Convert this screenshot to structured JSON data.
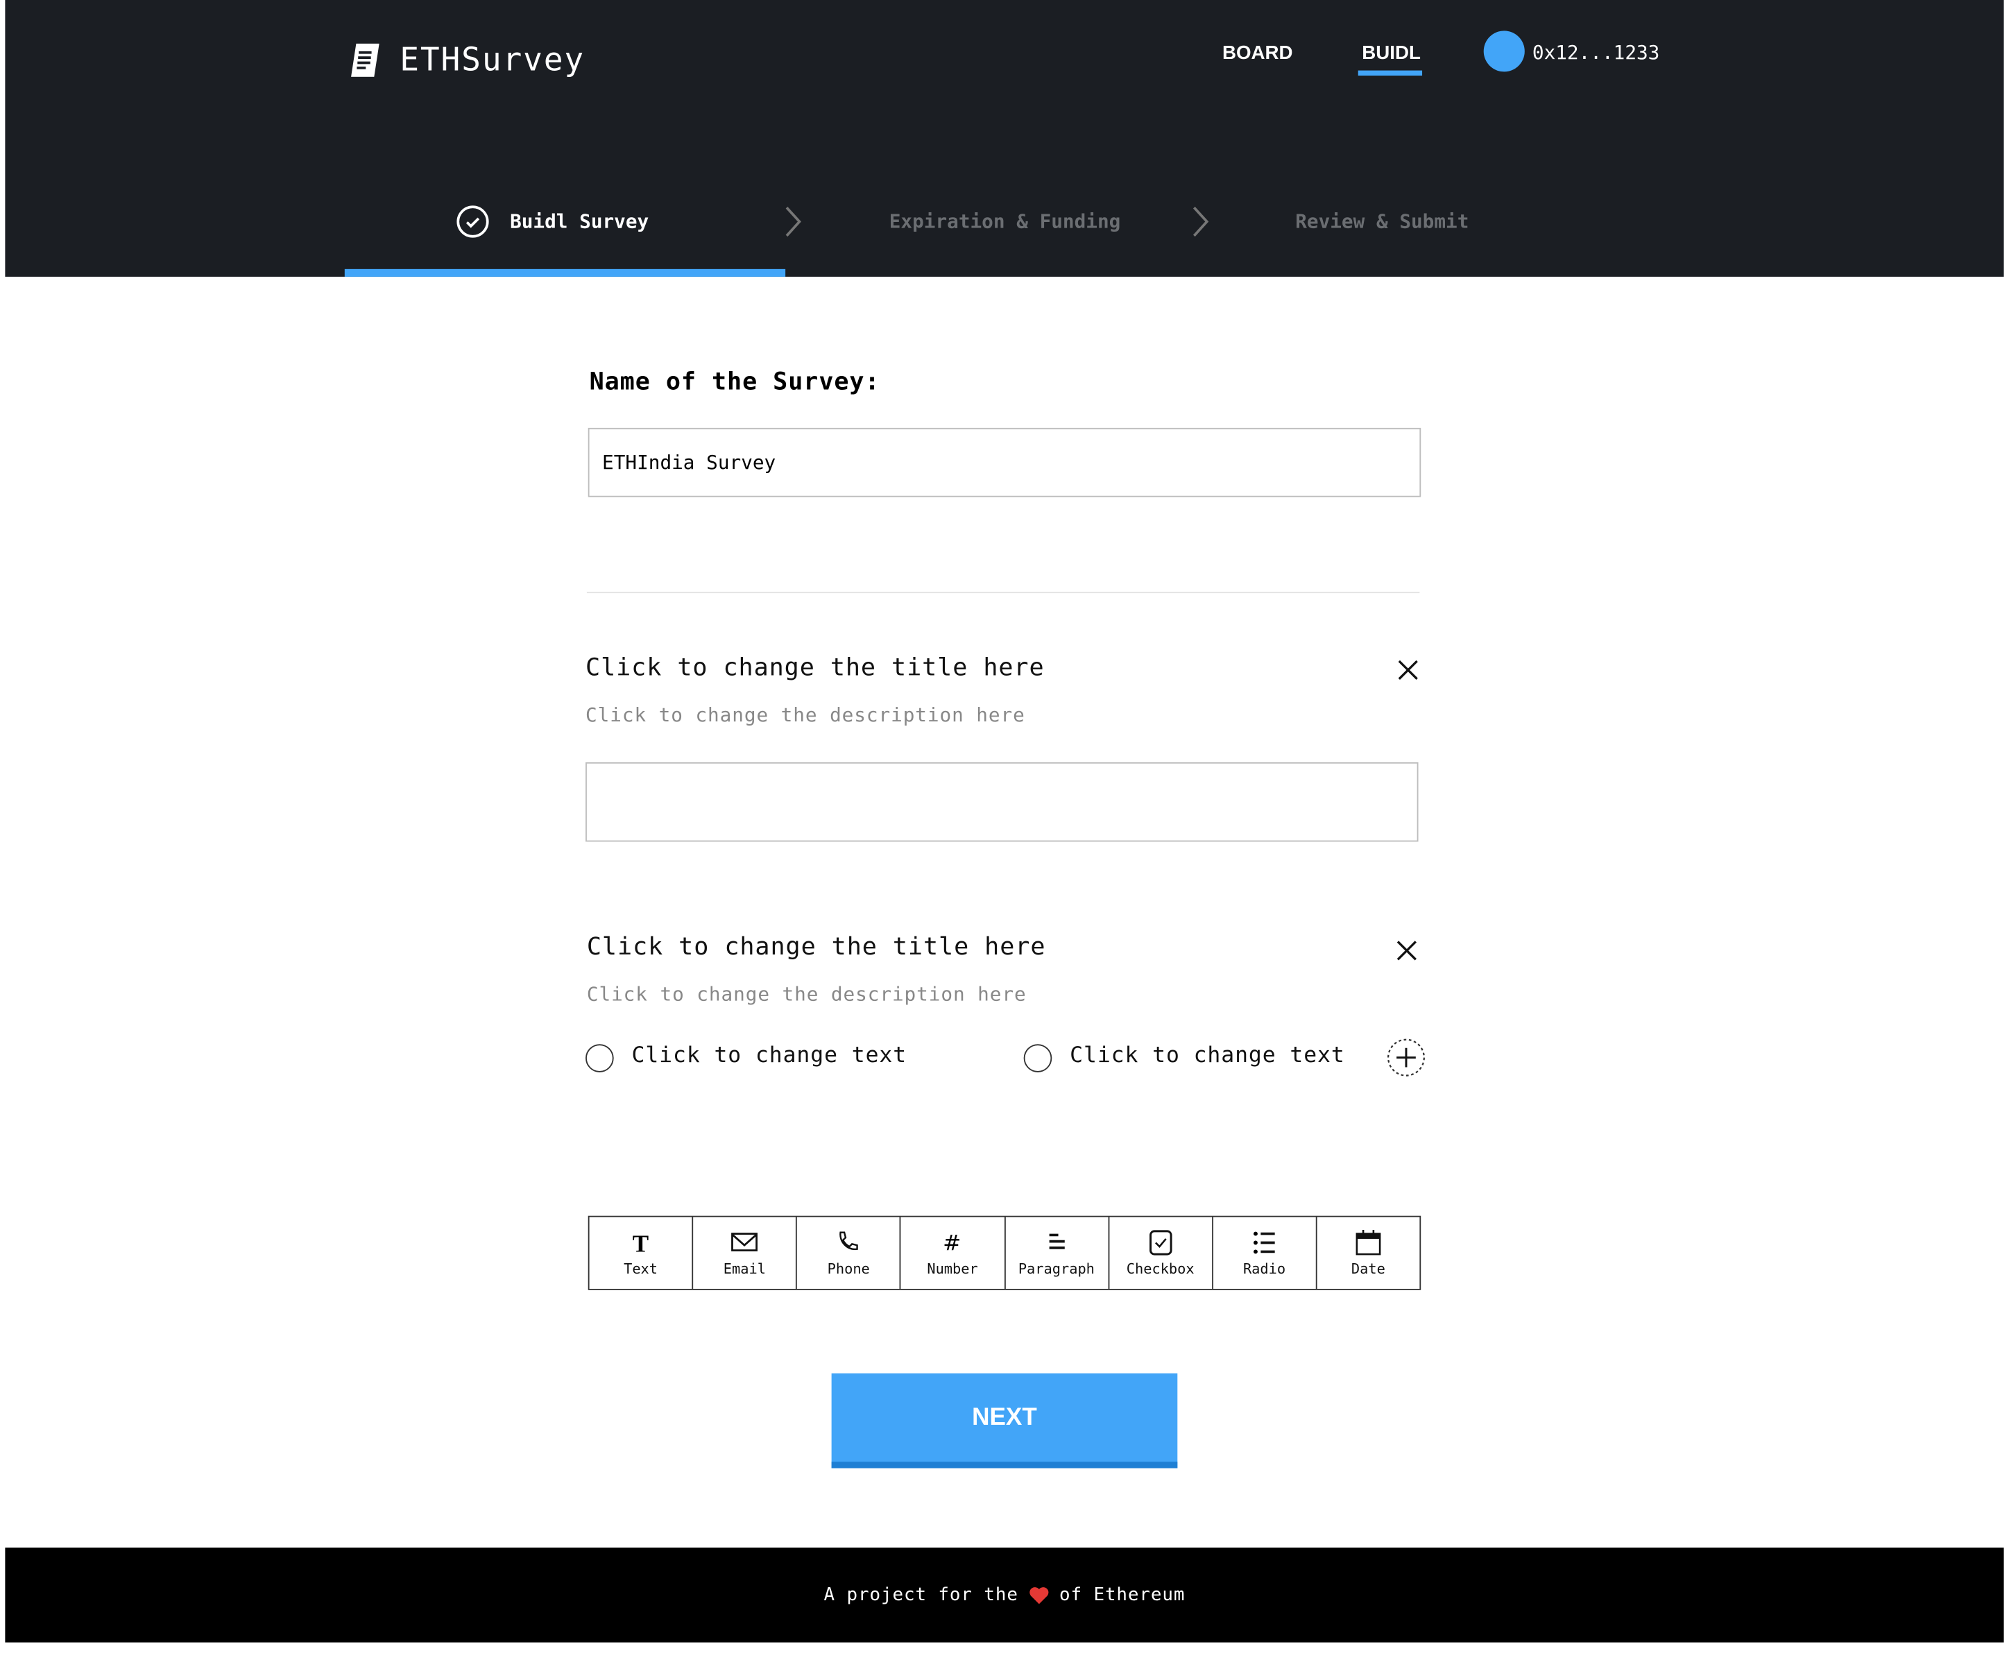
{
  "app": {
    "name": "ETHSurvey",
    "logo_icon": "document-icon"
  },
  "nav": {
    "items": [
      {
        "label": "BOARD",
        "active": false
      },
      {
        "label": "BUIDL",
        "active": true
      }
    ],
    "address": "0x12...1233"
  },
  "steps": [
    {
      "label": "Buidl Survey",
      "active": true,
      "icon": "check-circle-icon"
    },
    {
      "label": "Expiration & Funding",
      "active": false
    },
    {
      "label": "Review & Submit",
      "active": false
    }
  ],
  "survey": {
    "name_label": "Name of the Survey:",
    "name_value": "ETHIndia Survey"
  },
  "questions": [
    {
      "title": "Click to change the title here",
      "description": "Click to change the description here",
      "type": "text",
      "value": ""
    },
    {
      "title": "Click to change the title here",
      "description": "Click to change the description here",
      "type": "radio",
      "options": [
        "Click to change text",
        "Click to change text"
      ]
    }
  ],
  "toolbar": [
    {
      "label": "Text",
      "icon": "text-icon"
    },
    {
      "label": "Email",
      "icon": "email-icon"
    },
    {
      "label": "Phone",
      "icon": "phone-icon"
    },
    {
      "label": "Number",
      "icon": "hash-icon"
    },
    {
      "label": "Paragraph",
      "icon": "paragraph-icon"
    },
    {
      "label": "Checkbox",
      "icon": "checkbox-icon"
    },
    {
      "label": "Radio",
      "icon": "list-icon"
    },
    {
      "label": "Date",
      "icon": "calendar-icon"
    }
  ],
  "next_label": "NEXT",
  "footer": {
    "before": "A project for the",
    "after": "of Ethereum",
    "icon": "heart-icon"
  },
  "colors": {
    "accent": "#42a5f8",
    "header_bg": "#1b1e23",
    "footer_bg": "#000000",
    "heart": "#e53935"
  }
}
